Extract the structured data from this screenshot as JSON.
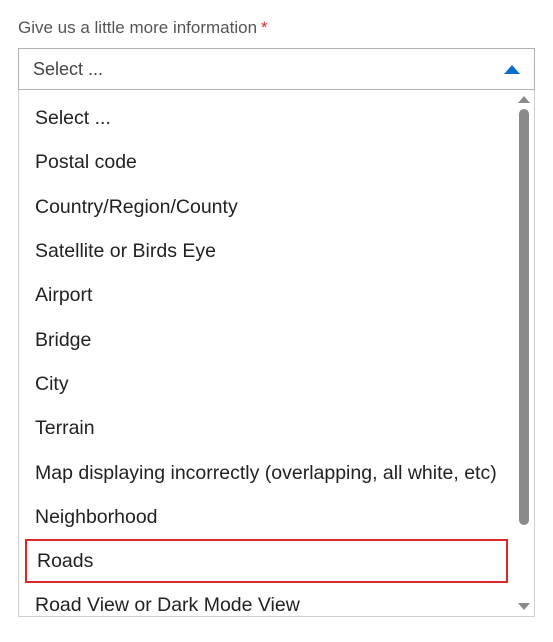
{
  "field": {
    "label": "Give us a little more information",
    "required_mark": "*",
    "selected_value": "Select ..."
  },
  "dropdown": {
    "options": [
      {
        "label": "Select ...",
        "highlighted": false
      },
      {
        "label": "Postal code",
        "highlighted": false
      },
      {
        "label": "Country/Region/County",
        "highlighted": false
      },
      {
        "label": "Satellite or Birds Eye",
        "highlighted": false
      },
      {
        "label": "Airport",
        "highlighted": false
      },
      {
        "label": "Bridge",
        "highlighted": false
      },
      {
        "label": "City",
        "highlighted": false
      },
      {
        "label": "Terrain",
        "highlighted": false
      },
      {
        "label": "Map displaying incorrectly (overlapping, all white, etc)",
        "highlighted": false
      },
      {
        "label": "Neighborhood",
        "highlighted": false
      },
      {
        "label": "Roads",
        "highlighted": true
      },
      {
        "label": "Road View or Dark Mode View",
        "highlighted": false
      }
    ]
  }
}
